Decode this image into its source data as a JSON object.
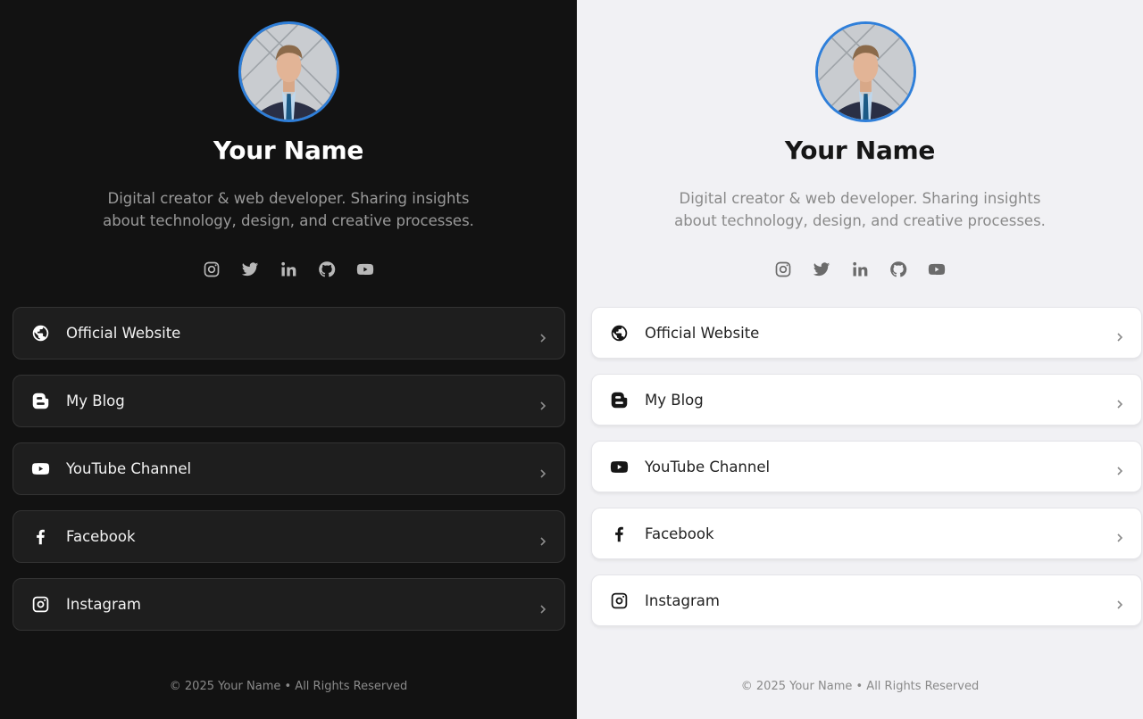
{
  "profile": {
    "name": "Your Name",
    "bio": "Digital creator & web developer. Sharing insights about technology, design, and creative processes.",
    "avatar_border_color": "#2f7fd9"
  },
  "socials": [
    {
      "icon": "instagram-icon"
    },
    {
      "icon": "twitter-icon"
    },
    {
      "icon": "linkedin-icon"
    },
    {
      "icon": "github-icon"
    },
    {
      "icon": "youtube-icon"
    }
  ],
  "links": [
    {
      "label": "Official Website",
      "icon": "globe-icon"
    },
    {
      "label": "My Blog",
      "icon": "blogger-icon"
    },
    {
      "label": "YouTube Channel",
      "icon": "youtube-icon"
    },
    {
      "label": "Facebook",
      "icon": "facebook-icon"
    },
    {
      "label": "Instagram",
      "icon": "instagram-icon"
    }
  ],
  "footer": "© 2025 Your Name • All Rights Reserved",
  "themes": {
    "dark": {
      "background": "#121212",
      "card": "#1e1e1e"
    },
    "light": {
      "background": "#f1f1f4",
      "card": "#ffffff"
    }
  }
}
